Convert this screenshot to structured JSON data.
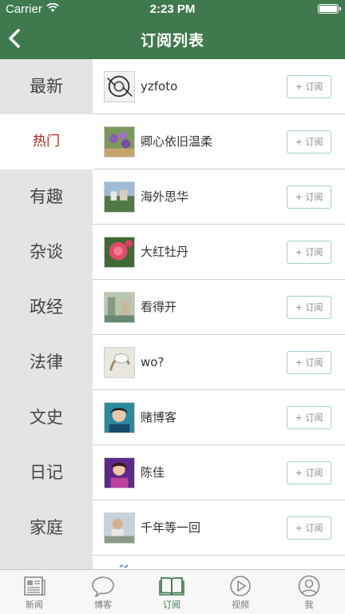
{
  "status": {
    "carrier": "Carrier",
    "time": "2:23 PM"
  },
  "nav": {
    "title": "订阅列表"
  },
  "categories": [
    {
      "label": "最新",
      "active": false
    },
    {
      "label": "热门",
      "active": true
    },
    {
      "label": "有趣",
      "active": false
    },
    {
      "label": "杂谈",
      "active": false
    },
    {
      "label": "政经",
      "active": false
    },
    {
      "label": "法律",
      "active": false
    },
    {
      "label": "文史",
      "active": false
    },
    {
      "label": "日记",
      "active": false
    },
    {
      "label": "家庭",
      "active": false
    }
  ],
  "subscriptions": [
    {
      "name": "yzfoto",
      "button": "+ 订阅"
    },
    {
      "name": "卿心依旧温柔",
      "button": "+ 订阅"
    },
    {
      "name": "海外思华",
      "button": "+ 订阅"
    },
    {
      "name": "大红牡丹",
      "button": "+ 订阅"
    },
    {
      "name": "看得开",
      "button": "+ 订阅"
    },
    {
      "name": "wo?",
      "button": "+ 订阅"
    },
    {
      "name": "赌博客",
      "button": "+ 订阅"
    },
    {
      "name": "陈佳",
      "button": "+ 订阅"
    },
    {
      "name": "千年等一回",
      "button": "+ 订阅"
    }
  ],
  "tabs": [
    {
      "label": "新闻",
      "icon": "newspaper-icon"
    },
    {
      "label": "博客",
      "icon": "speech-bubble-icon"
    },
    {
      "label": "订阅",
      "icon": "book-icon",
      "active": true
    },
    {
      "label": "视频",
      "icon": "play-icon"
    },
    {
      "label": "我",
      "icon": "user-icon"
    }
  ],
  "colors": {
    "header": "#3f7a4f",
    "active_category": "#b5211f",
    "category_bg": "#e4e4e4",
    "subscribe_border": "#9ed0d4"
  }
}
